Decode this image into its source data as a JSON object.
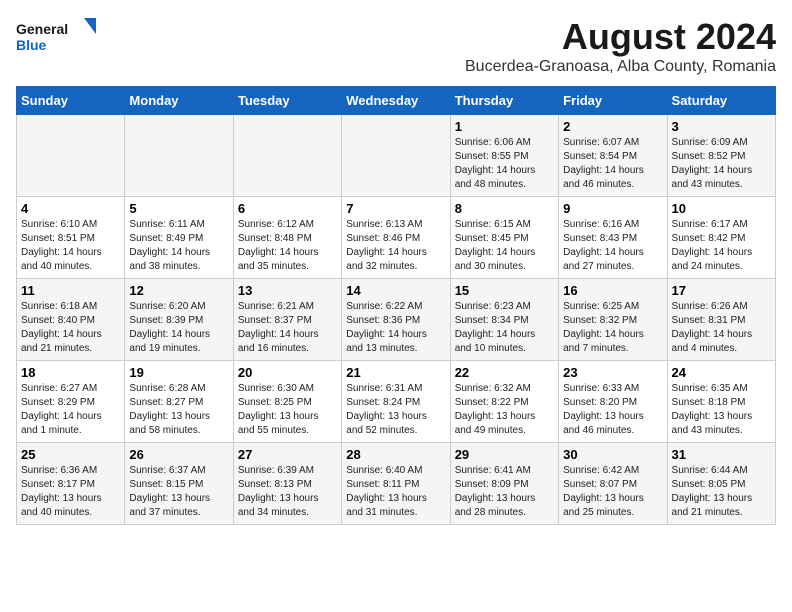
{
  "logo": {
    "line1": "General",
    "line2": "Blue"
  },
  "title": "August 2024",
  "subtitle": "Bucerdea-Granoasa, Alba County, Romania",
  "days_header": [
    "Sunday",
    "Monday",
    "Tuesday",
    "Wednesday",
    "Thursday",
    "Friday",
    "Saturday"
  ],
  "weeks": [
    [
      {
        "day": "",
        "info": ""
      },
      {
        "day": "",
        "info": ""
      },
      {
        "day": "",
        "info": ""
      },
      {
        "day": "",
        "info": ""
      },
      {
        "day": "1",
        "info": "Sunrise: 6:06 AM\nSunset: 8:55 PM\nDaylight: 14 hours and 48 minutes."
      },
      {
        "day": "2",
        "info": "Sunrise: 6:07 AM\nSunset: 8:54 PM\nDaylight: 14 hours and 46 minutes."
      },
      {
        "day": "3",
        "info": "Sunrise: 6:09 AM\nSunset: 8:52 PM\nDaylight: 14 hours and 43 minutes."
      }
    ],
    [
      {
        "day": "4",
        "info": "Sunrise: 6:10 AM\nSunset: 8:51 PM\nDaylight: 14 hours and 40 minutes."
      },
      {
        "day": "5",
        "info": "Sunrise: 6:11 AM\nSunset: 8:49 PM\nDaylight: 14 hours and 38 minutes."
      },
      {
        "day": "6",
        "info": "Sunrise: 6:12 AM\nSunset: 8:48 PM\nDaylight: 14 hours and 35 minutes."
      },
      {
        "day": "7",
        "info": "Sunrise: 6:13 AM\nSunset: 8:46 PM\nDaylight: 14 hours and 32 minutes."
      },
      {
        "day": "8",
        "info": "Sunrise: 6:15 AM\nSunset: 8:45 PM\nDaylight: 14 hours and 30 minutes."
      },
      {
        "day": "9",
        "info": "Sunrise: 6:16 AM\nSunset: 8:43 PM\nDaylight: 14 hours and 27 minutes."
      },
      {
        "day": "10",
        "info": "Sunrise: 6:17 AM\nSunset: 8:42 PM\nDaylight: 14 hours and 24 minutes."
      }
    ],
    [
      {
        "day": "11",
        "info": "Sunrise: 6:18 AM\nSunset: 8:40 PM\nDaylight: 14 hours and 21 minutes."
      },
      {
        "day": "12",
        "info": "Sunrise: 6:20 AM\nSunset: 8:39 PM\nDaylight: 14 hours and 19 minutes."
      },
      {
        "day": "13",
        "info": "Sunrise: 6:21 AM\nSunset: 8:37 PM\nDaylight: 14 hours and 16 minutes."
      },
      {
        "day": "14",
        "info": "Sunrise: 6:22 AM\nSunset: 8:36 PM\nDaylight: 14 hours and 13 minutes."
      },
      {
        "day": "15",
        "info": "Sunrise: 6:23 AM\nSunset: 8:34 PM\nDaylight: 14 hours and 10 minutes."
      },
      {
        "day": "16",
        "info": "Sunrise: 6:25 AM\nSunset: 8:32 PM\nDaylight: 14 hours and 7 minutes."
      },
      {
        "day": "17",
        "info": "Sunrise: 6:26 AM\nSunset: 8:31 PM\nDaylight: 14 hours and 4 minutes."
      }
    ],
    [
      {
        "day": "18",
        "info": "Sunrise: 6:27 AM\nSunset: 8:29 PM\nDaylight: 14 hours and 1 minute."
      },
      {
        "day": "19",
        "info": "Sunrise: 6:28 AM\nSunset: 8:27 PM\nDaylight: 13 hours and 58 minutes."
      },
      {
        "day": "20",
        "info": "Sunrise: 6:30 AM\nSunset: 8:25 PM\nDaylight: 13 hours and 55 minutes."
      },
      {
        "day": "21",
        "info": "Sunrise: 6:31 AM\nSunset: 8:24 PM\nDaylight: 13 hours and 52 minutes."
      },
      {
        "day": "22",
        "info": "Sunrise: 6:32 AM\nSunset: 8:22 PM\nDaylight: 13 hours and 49 minutes."
      },
      {
        "day": "23",
        "info": "Sunrise: 6:33 AM\nSunset: 8:20 PM\nDaylight: 13 hours and 46 minutes."
      },
      {
        "day": "24",
        "info": "Sunrise: 6:35 AM\nSunset: 8:18 PM\nDaylight: 13 hours and 43 minutes."
      }
    ],
    [
      {
        "day": "25",
        "info": "Sunrise: 6:36 AM\nSunset: 8:17 PM\nDaylight: 13 hours and 40 minutes."
      },
      {
        "day": "26",
        "info": "Sunrise: 6:37 AM\nSunset: 8:15 PM\nDaylight: 13 hours and 37 minutes."
      },
      {
        "day": "27",
        "info": "Sunrise: 6:39 AM\nSunset: 8:13 PM\nDaylight: 13 hours and 34 minutes."
      },
      {
        "day": "28",
        "info": "Sunrise: 6:40 AM\nSunset: 8:11 PM\nDaylight: 13 hours and 31 minutes."
      },
      {
        "day": "29",
        "info": "Sunrise: 6:41 AM\nSunset: 8:09 PM\nDaylight: 13 hours and 28 minutes."
      },
      {
        "day": "30",
        "info": "Sunrise: 6:42 AM\nSunset: 8:07 PM\nDaylight: 13 hours and 25 minutes."
      },
      {
        "day": "31",
        "info": "Sunrise: 6:44 AM\nSunset: 8:05 PM\nDaylight: 13 hours and 21 minutes."
      }
    ]
  ]
}
